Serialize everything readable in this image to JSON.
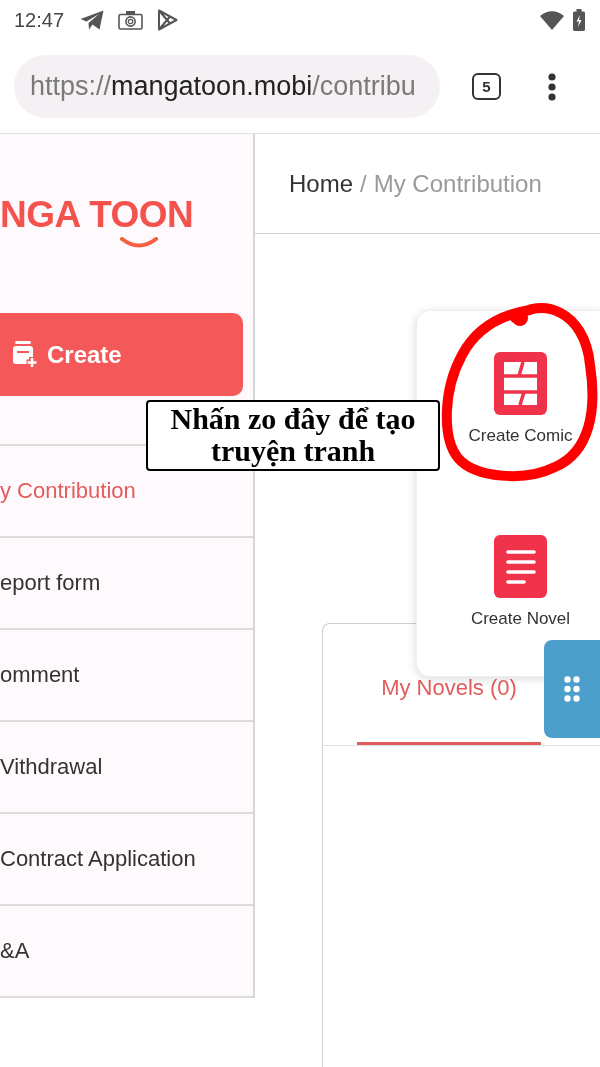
{
  "status_bar": {
    "time": "12:47"
  },
  "browser": {
    "url": {
      "scheme": "https://",
      "host": "mangatoon.mobi",
      "path": "/contribu"
    },
    "tab_count": "5"
  },
  "sidebar": {
    "logo": "NGA TOON",
    "create_button": "Create",
    "items": [
      {
        "label": "y Contribution",
        "selected": true
      },
      {
        "label": "eport form",
        "selected": false
      },
      {
        "label": "omment",
        "selected": false
      },
      {
        "label": "Vithdrawal",
        "selected": false
      },
      {
        "label": "Contract Application",
        "selected": false
      },
      {
        "label": "&A",
        "selected": false
      }
    ]
  },
  "breadcrumb": {
    "items": [
      {
        "label": "Home",
        "current": false
      },
      {
        "label": "My Contribution",
        "current": true
      }
    ],
    "separator": "/"
  },
  "create_menu": {
    "items": [
      {
        "kind": "comic",
        "label": "Create Comic"
      },
      {
        "kind": "novel",
        "label": "Create Novel"
      }
    ]
  },
  "tabs": [
    {
      "label": "My Novels (0)",
      "selected": true
    }
  ],
  "annotation": {
    "text": "Nhấn zo đây để tạo truyện tranh"
  }
}
